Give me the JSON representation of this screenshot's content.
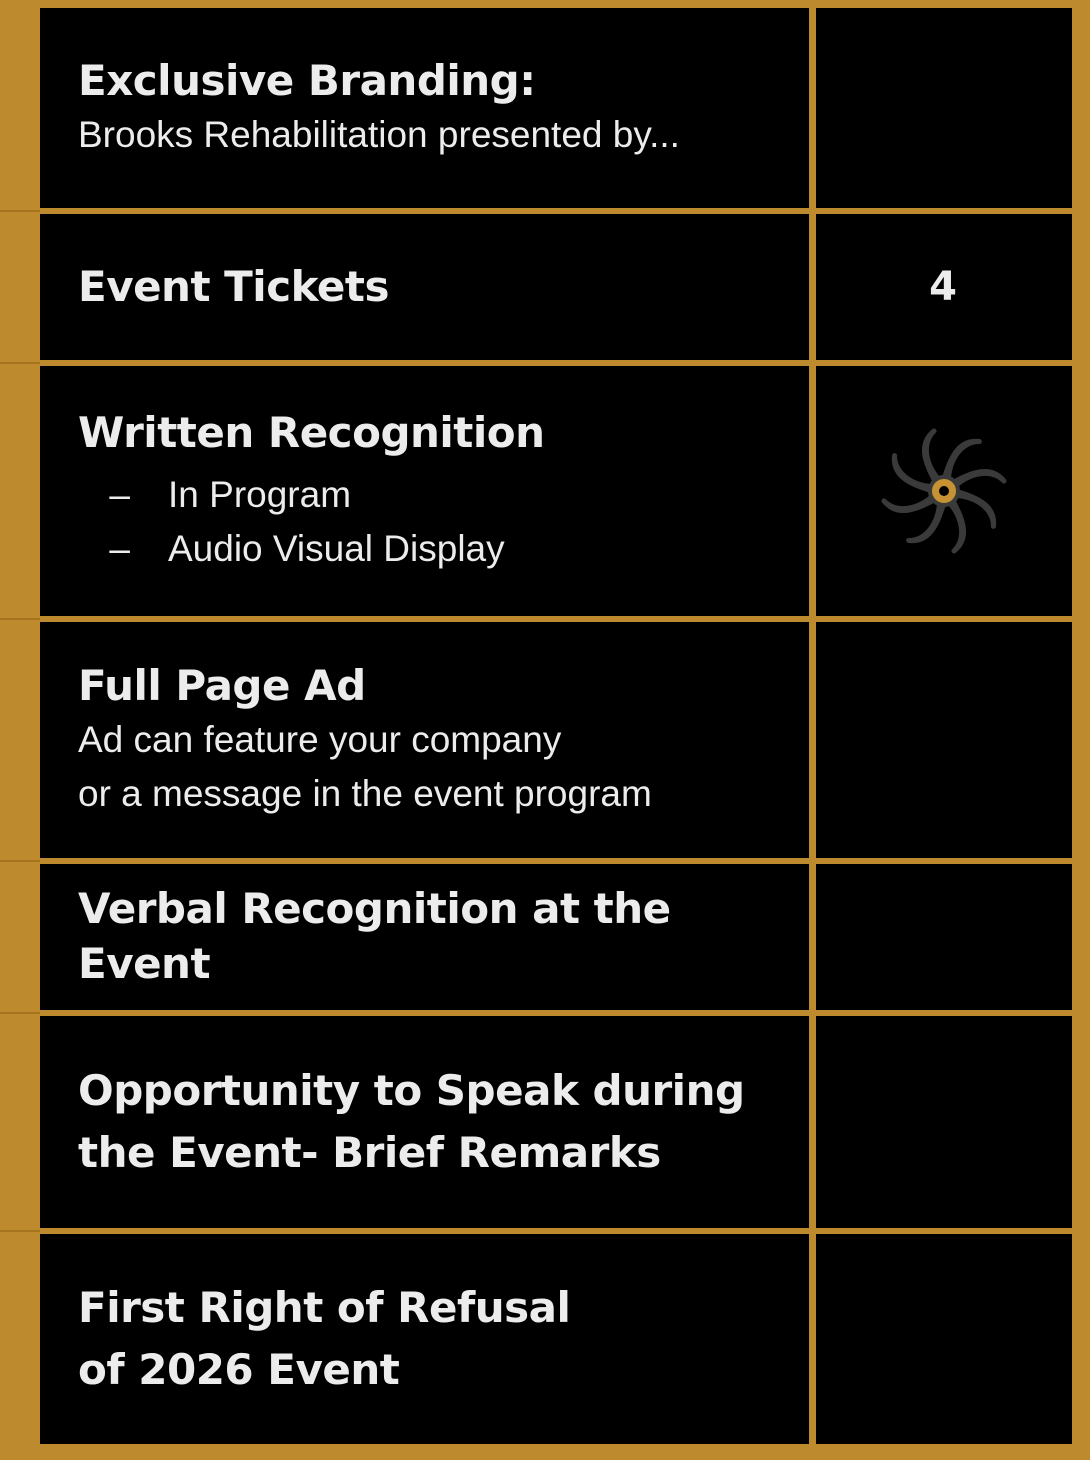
{
  "rows": [
    {
      "title": "Exclusive Branding:",
      "subtitle": "Brooks Rehabilitation presented by..."
    },
    {
      "title": "Event Tickets",
      "value": "4"
    },
    {
      "title": "Written Recognition",
      "list": [
        {
          "bullet": "–",
          "text": "In Program"
        },
        {
          "bullet": "–",
          "text": "Audio Visual Display"
        }
      ],
      "icon": "swirl-badge-icon"
    },
    {
      "title": "Full Page Ad",
      "subtitle_lines": [
        "Ad can feature your company",
        "or a message in the event program"
      ]
    },
    {
      "title": "Verbal Recognition at the Event"
    },
    {
      "title_lines": [
        "Opportunity to Speak during",
        "the Event- Brief Remarks"
      ]
    },
    {
      "title_lines": [
        "First Right of Refusal",
        "of 2026 Event"
      ]
    }
  ],
  "colors": {
    "border": "#be8a2e",
    "cell": "#000000",
    "text": "#ececec",
    "icon_fill": "#c79234",
    "icon_outline": "#3a3a3a"
  }
}
